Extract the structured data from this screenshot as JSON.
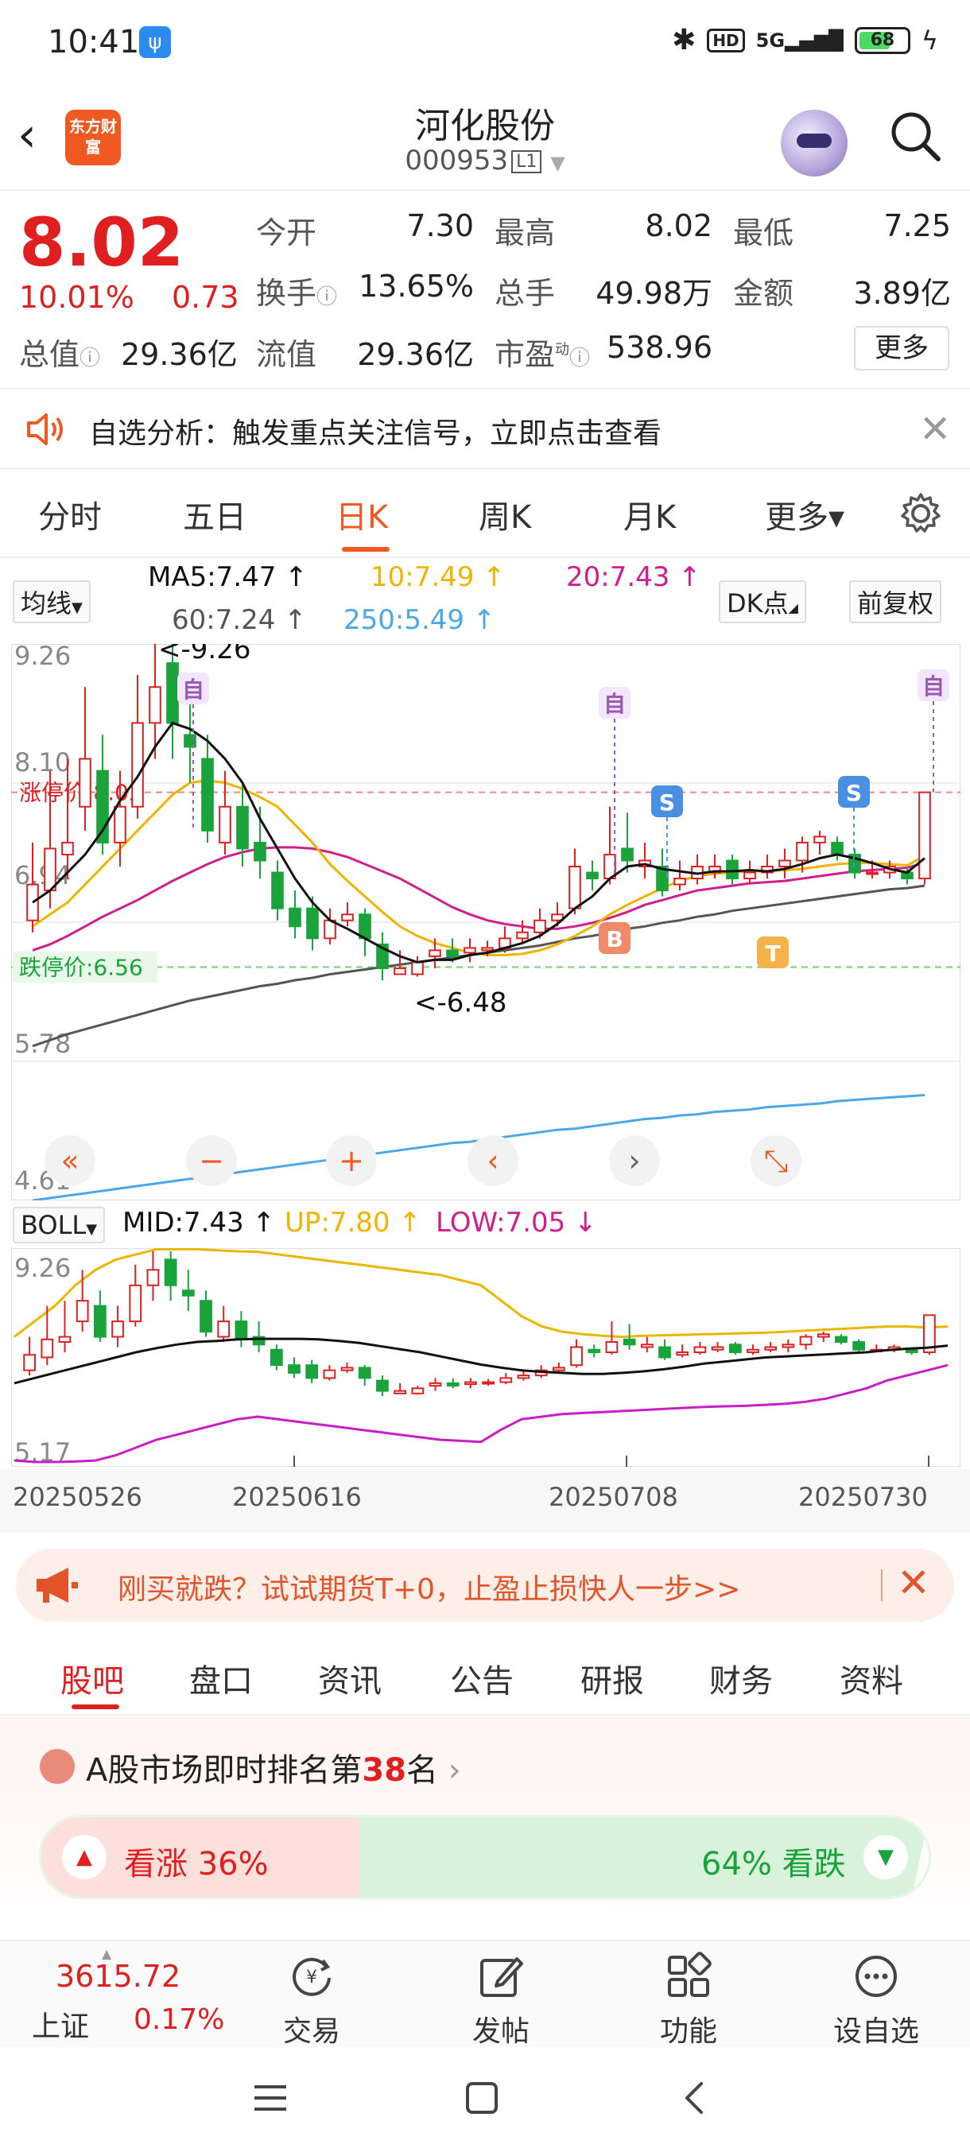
{
  "status_bar": {
    "time": "10:41",
    "battery": "68",
    "network": "5G",
    "hd": "HD"
  },
  "header": {
    "logo_text": "东方财富",
    "stock_name": "河化股份",
    "stock_code": "000953",
    "level": "L1"
  },
  "quote": {
    "price": "8.02",
    "change_pct": "10.01%",
    "change": "0.73",
    "open_label": "今开",
    "open": "7.30",
    "high_label": "最高",
    "high": "8.02",
    "low_label": "最低",
    "low": "7.25",
    "turnover_label": "换手",
    "turnover": "13.65%",
    "volume_label": "总手",
    "volume": "49.98万",
    "amount_label": "金额",
    "amount": "3.89亿",
    "mktcap_label": "总值",
    "mktcap": "29.36亿",
    "float_label": "流值",
    "float_cap": "29.36亿",
    "pe_label": "市盈",
    "pe_sup": "动",
    "pe": "538.96",
    "more_label": "更多"
  },
  "notice": {
    "text": "自选分析：触发重点关注信号，立即点击查看"
  },
  "period_tabs": [
    {
      "label": "分时"
    },
    {
      "label": "五日"
    },
    {
      "label": "日K"
    },
    {
      "label": "周K"
    },
    {
      "label": "月K"
    },
    {
      "label": "更多▾"
    }
  ],
  "ma_legend": {
    "indicator_select": "均线",
    "ma5": "MA5:7.47 ↑",
    "ma10": "10:7.49 ↑",
    "ma20": "20:7.43 ↑",
    "ma60": "60:7.24 ↑",
    "ma250": "250:5.49 ↑",
    "dk_button": "DK点",
    "adjust_button": "前复权"
  },
  "boll_legend": {
    "indicator_select": "BOLL",
    "mid": "MID:7.43 ↑",
    "up": "UP:7.80 ↑",
    "low": "LOW:7.05 ↓"
  },
  "chart_data": [
    {
      "type": "candlestick",
      "title": "日K",
      "y_ticks": [
        "9.26",
        "8.10",
        "6.94",
        "5.78",
        "4.61"
      ],
      "ylim": [
        4.61,
        9.26
      ],
      "limit_up_label": "涨停价:8.02",
      "limit_up_value": 8.02,
      "limit_down_label": "跌停价:6.56",
      "limit_down_value": 6.56,
      "annotations": [
        "<-9.26",
        "<-6.48"
      ],
      "markers": [
        "自",
        "自",
        "自",
        "S",
        "S",
        "B",
        "T"
      ],
      "candles": [
        {
          "o": 6.95,
          "c": 7.25,
          "h": 7.6,
          "l": 6.85
        },
        {
          "o": 7.2,
          "c": 7.55,
          "h": 8.2,
          "l": 7.05
        },
        {
          "o": 7.5,
          "c": 7.6,
          "h": 8.3,
          "l": 7.3
        },
        {
          "o": 7.9,
          "c": 8.3,
          "h": 8.9,
          "l": 7.7
        },
        {
          "o": 8.2,
          "c": 7.6,
          "h": 8.5,
          "l": 7.5
        },
        {
          "o": 7.6,
          "c": 7.9,
          "h": 8.2,
          "l": 7.4
        },
        {
          "o": 7.9,
          "c": 8.6,
          "h": 9.0,
          "l": 7.8
        },
        {
          "o": 8.6,
          "c": 8.9,
          "h": 9.26,
          "l": 8.3
        },
        {
          "o": 9.1,
          "c": 8.6,
          "h": 9.26,
          "l": 8.3
        },
        {
          "o": 8.5,
          "c": 8.4,
          "h": 8.9,
          "l": 8.1
        },
        {
          "o": 8.3,
          "c": 7.7,
          "h": 8.5,
          "l": 7.6
        },
        {
          "o": 7.6,
          "c": 7.9,
          "h": 8.2,
          "l": 7.5
        },
        {
          "o": 7.9,
          "c": 7.55,
          "h": 8.1,
          "l": 7.4
        },
        {
          "o": 7.6,
          "c": 7.45,
          "h": 7.9,
          "l": 7.3
        },
        {
          "o": 7.35,
          "c": 7.05,
          "h": 7.45,
          "l": 6.95
        },
        {
          "o": 7.05,
          "c": 6.9,
          "h": 7.2,
          "l": 6.8
        },
        {
          "o": 7.05,
          "c": 6.8,
          "h": 7.15,
          "l": 6.7
        },
        {
          "o": 6.8,
          "c": 6.95,
          "h": 7.05,
          "l": 6.75
        },
        {
          "o": 6.95,
          "c": 7.0,
          "h": 7.1,
          "l": 6.9
        },
        {
          "o": 7.0,
          "c": 6.8,
          "h": 7.05,
          "l": 6.65
        },
        {
          "o": 6.75,
          "c": 6.55,
          "h": 6.85,
          "l": 6.45
        },
        {
          "o": 6.5,
          "c": 6.55,
          "h": 6.7,
          "l": 6.5
        },
        {
          "o": 6.5,
          "c": 6.6,
          "h": 6.65,
          "l": 6.48
        },
        {
          "o": 6.65,
          "c": 6.7,
          "h": 6.8,
          "l": 6.55
        },
        {
          "o": 6.7,
          "c": 6.65,
          "h": 6.8,
          "l": 6.6
        },
        {
          "o": 6.68,
          "c": 6.72,
          "h": 6.8,
          "l": 6.6
        },
        {
          "o": 6.7,
          "c": 6.72,
          "h": 6.78,
          "l": 6.65
        },
        {
          "o": 6.72,
          "c": 6.8,
          "h": 6.9,
          "l": 6.68
        },
        {
          "o": 6.8,
          "c": 6.85,
          "h": 6.95,
          "l": 6.75
        },
        {
          "o": 6.85,
          "c": 6.95,
          "h": 7.05,
          "l": 6.8
        },
        {
          "o": 6.95,
          "c": 7.0,
          "h": 7.1,
          "l": 6.9
        },
        {
          "o": 7.05,
          "c": 7.4,
          "h": 7.55,
          "l": 7.0
        },
        {
          "o": 7.35,
          "c": 7.3,
          "h": 7.45,
          "l": 7.2
        },
        {
          "o": 7.3,
          "c": 7.5,
          "h": 7.9,
          "l": 7.25
        },
        {
          "o": 7.55,
          "c": 7.45,
          "h": 7.85,
          "l": 7.35
        },
        {
          "o": 7.4,
          "c": 7.45,
          "h": 7.6,
          "l": 7.3
        },
        {
          "o": 7.4,
          "c": 7.2,
          "h": 7.55,
          "l": 7.15
        },
        {
          "o": 7.25,
          "c": 7.3,
          "h": 7.45,
          "l": 7.2
        },
        {
          "o": 7.3,
          "c": 7.4,
          "h": 7.5,
          "l": 7.25
        },
        {
          "o": 7.35,
          "c": 7.4,
          "h": 7.5,
          "l": 7.3
        },
        {
          "o": 7.45,
          "c": 7.3,
          "h": 7.5,
          "l": 7.25
        },
        {
          "o": 7.3,
          "c": 7.35,
          "h": 7.45,
          "l": 7.25
        },
        {
          "o": 7.35,
          "c": 7.4,
          "h": 7.5,
          "l": 7.3
        },
        {
          "o": 7.4,
          "c": 7.45,
          "h": 7.55,
          "l": 7.3
        },
        {
          "o": 7.45,
          "c": 7.6,
          "h": 7.65,
          "l": 7.35
        },
        {
          "o": 7.6,
          "c": 7.65,
          "h": 7.7,
          "l": 7.5
        },
        {
          "o": 7.6,
          "c": 7.5,
          "h": 7.65,
          "l": 7.45
        },
        {
          "o": 7.5,
          "c": 7.35,
          "h": 7.55,
          "l": 7.3
        },
        {
          "o": 7.35,
          "c": 7.35,
          "h": 7.45,
          "l": 7.3
        },
        {
          "o": 7.35,
          "c": 7.4,
          "h": 7.45,
          "l": 7.3
        },
        {
          "o": 7.35,
          "c": 7.3,
          "h": 7.4,
          "l": 7.25
        },
        {
          "o": 7.3,
          "c": 8.02,
          "h": 8.02,
          "l": 7.25
        }
      ],
      "ma5": [
        7.1,
        7.2,
        7.35,
        7.5,
        7.7,
        7.95,
        8.15,
        8.4,
        8.6,
        8.55,
        8.45,
        8.3,
        8.1,
        7.8,
        7.55,
        7.3,
        7.1,
        6.95,
        6.88,
        6.8,
        6.72,
        6.65,
        6.6,
        6.62,
        6.62,
        6.66,
        6.68,
        6.72,
        6.76,
        6.82,
        6.92,
        7.05,
        7.15,
        7.3,
        7.4,
        7.42,
        7.38,
        7.36,
        7.34,
        7.36,
        7.36,
        7.37,
        7.36,
        7.38,
        7.42,
        7.47,
        7.5,
        7.47,
        7.43,
        7.38,
        7.35,
        7.47
      ],
      "ma10": [
        6.9,
        7.0,
        7.1,
        7.25,
        7.4,
        7.55,
        7.7,
        7.85,
        8.0,
        8.1,
        8.12,
        8.1,
        8.05,
        7.98,
        7.9,
        7.75,
        7.6,
        7.42,
        7.28,
        7.15,
        7.02,
        6.9,
        6.82,
        6.76,
        6.72,
        6.68,
        6.66,
        6.66,
        6.67,
        6.7,
        6.75,
        6.82,
        6.9,
        7.0,
        7.08,
        7.15,
        7.22,
        7.28,
        7.32,
        7.34,
        7.35,
        7.36,
        7.36,
        7.37,
        7.38,
        7.4,
        7.42,
        7.43,
        7.43,
        7.42,
        7.41,
        7.49
      ],
      "ma20": [
        6.7,
        6.75,
        6.82,
        6.9,
        6.98,
        7.05,
        7.12,
        7.2,
        7.28,
        7.35,
        7.42,
        7.48,
        7.52,
        7.55,
        7.56,
        7.56,
        7.55,
        7.52,
        7.48,
        7.42,
        7.36,
        7.3,
        7.22,
        7.14,
        7.06,
        7.0,
        6.95,
        6.92,
        6.9,
        6.88,
        6.88,
        6.9,
        6.93,
        6.97,
        7.02,
        7.08,
        7.12,
        7.16,
        7.2,
        7.22,
        7.24,
        7.26,
        7.27,
        7.28,
        7.3,
        7.32,
        7.34,
        7.36,
        7.37,
        7.38,
        7.39,
        7.43
      ],
      "ma60": [
        5.9,
        5.95,
        6.0,
        6.04,
        6.08,
        6.12,
        6.16,
        6.2,
        6.24,
        6.28,
        6.31,
        6.34,
        6.37,
        6.4,
        6.42,
        6.45,
        6.47,
        6.5,
        6.52,
        6.54,
        6.56,
        6.58,
        6.6,
        6.62,
        6.64,
        6.66,
        6.68,
        6.7,
        6.72,
        6.74,
        6.77,
        6.8,
        6.82,
        6.85,
        6.88,
        6.9,
        6.93,
        6.95,
        6.98,
        7.0,
        7.03,
        7.05,
        7.07,
        7.09,
        7.11,
        7.13,
        7.15,
        7.17,
        7.19,
        7.21,
        7.22,
        7.24
      ],
      "ma250": [
        4.61,
        4.63,
        4.65,
        4.67,
        4.69,
        4.71,
        4.73,
        4.75,
        4.77,
        4.79,
        4.81,
        4.83,
        4.85,
        4.87,
        4.89,
        4.91,
        4.93,
        4.95,
        4.97,
        4.99,
        5.01,
        5.03,
        5.05,
        5.07,
        5.09,
        5.1,
        5.12,
        5.14,
        5.16,
        5.18,
        5.2,
        5.21,
        5.23,
        5.25,
        5.27,
        5.29,
        5.3,
        5.32,
        5.33,
        5.35,
        5.36,
        5.37,
        5.39,
        5.4,
        5.41,
        5.42,
        5.44,
        5.45,
        5.46,
        5.47,
        5.48,
        5.49
      ]
    },
    {
      "type": "candlestick",
      "title": "BOLL",
      "y_ticks": [
        "9.26",
        "5.17"
      ],
      "ylim": [
        5.17,
        9.26
      ],
      "x_ticks": [
        "20250526",
        "20250616",
        "20250708",
        "20250730"
      ],
      "up_band": [
        7.6,
        7.9,
        8.2,
        8.6,
        8.9,
        9.1,
        9.2,
        9.3,
        9.3,
        9.3,
        9.28,
        9.26,
        9.25,
        9.2,
        9.15,
        9.1,
        9.05,
        9.0,
        8.95,
        8.9,
        8.85,
        8.8,
        8.7,
        8.6,
        8.3,
        8.0,
        7.8,
        7.7,
        7.65,
        7.62,
        7.6,
        7.62,
        7.63,
        7.64,
        7.65,
        7.66,
        7.67,
        7.68,
        7.7,
        7.72,
        7.74,
        7.76,
        7.78,
        7.8,
        7.8,
        7.78,
        7.8
      ],
      "mid_band": [
        6.7,
        6.8,
        6.9,
        7.0,
        7.1,
        7.2,
        7.3,
        7.38,
        7.45,
        7.5,
        7.52,
        7.55,
        7.56,
        7.56,
        7.56,
        7.55,
        7.52,
        7.48,
        7.42,
        7.36,
        7.3,
        7.22,
        7.14,
        7.06,
        7.0,
        6.95,
        6.92,
        6.9,
        6.88,
        6.88,
        6.9,
        6.93,
        6.97,
        7.02,
        7.08,
        7.12,
        7.16,
        7.2,
        7.22,
        7.24,
        7.26,
        7.28,
        7.3,
        7.34,
        7.37,
        7.39,
        7.43
      ],
      "low_band": [
        5.2,
        5.17,
        5.17,
        5.18,
        5.2,
        5.3,
        5.45,
        5.6,
        5.7,
        5.8,
        5.9,
        6.0,
        6.05,
        6.0,
        5.95,
        5.9,
        5.85,
        5.8,
        5.75,
        5.7,
        5.65,
        5.6,
        5.58,
        5.56,
        5.8,
        6.0,
        6.05,
        6.1,
        6.12,
        6.14,
        6.16,
        6.18,
        6.2,
        6.22,
        6.24,
        6.25,
        6.26,
        6.28,
        6.3,
        6.34,
        6.4,
        6.5,
        6.6,
        6.75,
        6.85,
        6.95,
        7.05
      ]
    }
  ],
  "chart_controls": [
    "«",
    "−",
    "+",
    "‹",
    "›",
    "⤡"
  ],
  "promo": {
    "text": "刚买就跌？试试期货T+0，止盈止损快人一步>>"
  },
  "info_tabs": [
    {
      "label": "股吧"
    },
    {
      "label": "盘口"
    },
    {
      "label": "资讯"
    },
    {
      "label": "公告"
    },
    {
      "label": "研报"
    },
    {
      "label": "财务"
    },
    {
      "label": "资料"
    }
  ],
  "ranking": {
    "prefix": "A股市场即时排名第",
    "rank": "38",
    "suffix": "名",
    "up_label": "看涨 36%",
    "down_label": "64% 看跌",
    "up_pct": 36,
    "down_pct": 64
  },
  "bottom_bar": {
    "index_value": "3615.72",
    "index_name": "上证",
    "index_pct": "0.17%",
    "items": [
      {
        "label": "交易"
      },
      {
        "label": "发帖"
      },
      {
        "label": "功能"
      },
      {
        "label": "设自选"
      }
    ]
  },
  "colors": {
    "up": "#e02020",
    "down": "#19a33a",
    "accent": "#f05a22",
    "ma5": "#111111",
    "ma10": "#f0b400",
    "ma20": "#d01e8c",
    "ma60": "#555555",
    "ma250": "#4aa8e8"
  }
}
